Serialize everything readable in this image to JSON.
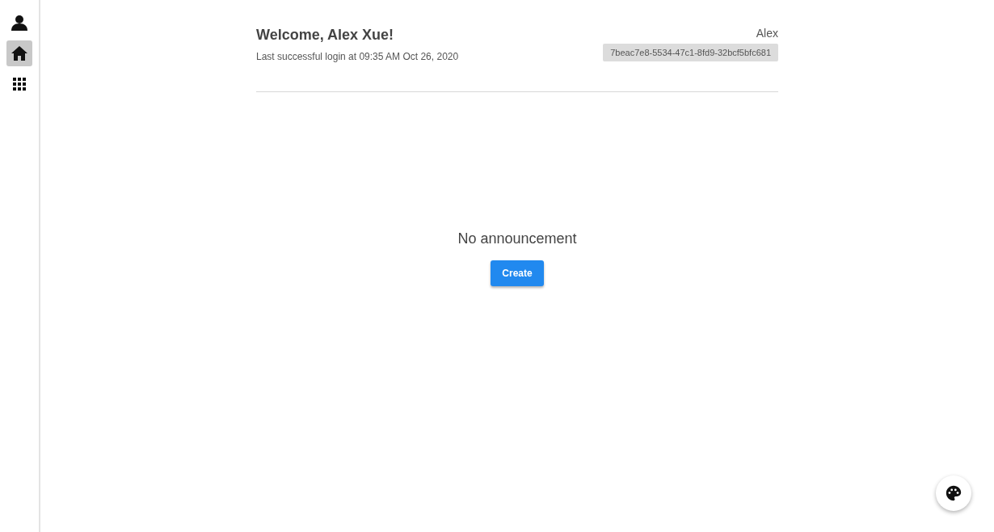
{
  "sidebar": {
    "items": [
      {
        "kind": "profile",
        "selected": false
      },
      {
        "kind": "home",
        "selected": true
      },
      {
        "kind": "apps",
        "selected": false
      }
    ]
  },
  "header": {
    "welcome": "Welcome, Alex Xue!",
    "last_login": "Last successful login at 09:35 AM Oct 26, 2020",
    "username": "Alex",
    "user_id": "7beac7e8-5534-47c1-8fd9-32bcf5bfc681"
  },
  "announcements": {
    "empty_message": "No announcement",
    "create_button": "Create"
  }
}
